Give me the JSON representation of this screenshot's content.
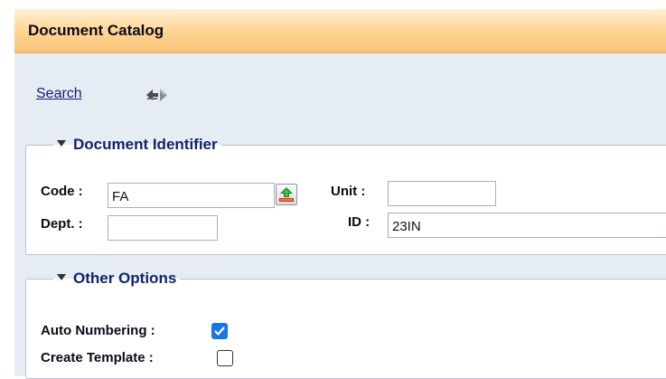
{
  "header": {
    "title": "Document Catalog"
  },
  "toolbar": {
    "search_label": "Search",
    "nav_icon": "prev-next-arrows-icon"
  },
  "document_identifier": {
    "legend": "Document Identifier",
    "code_label": "Code :",
    "code_value": "FA",
    "lookup_icon": "upload-lookup-icon",
    "unit_label": "Unit :",
    "unit_value": "",
    "dept_label": "Dept. :",
    "dept_value": "",
    "id_label": "ID :",
    "id_value": "23IN"
  },
  "other_options": {
    "legend": "Other Options",
    "auto_numbering_label": "Auto Numbering :",
    "auto_numbering_checked": true,
    "create_template_label": "Create Template :",
    "create_template_checked": false
  },
  "colors": {
    "header_gradient_top": "#fff2d8",
    "header_gradient_bottom": "#f9c278",
    "panel_bg": "#e6ecf3",
    "legend_text": "#10246e",
    "checkbox_accent": "#1a73e8"
  }
}
